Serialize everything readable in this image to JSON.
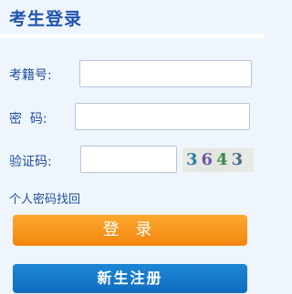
{
  "header": {
    "title": "考生登录"
  },
  "form": {
    "username_label": "考籍号:",
    "username_value": "",
    "password_label": "密  码:",
    "password_value": "",
    "captcha_label": "验证码:",
    "captcha_value": "",
    "captcha_image_text": [
      "3",
      "6",
      "4",
      "3"
    ]
  },
  "links": {
    "forgot_password": "个人密码找回"
  },
  "buttons": {
    "login_label": "登 录",
    "register_label": "新生注册"
  },
  "colors": {
    "title": "#1f55b0",
    "login_button": "#f6920f",
    "register_button": "#1677cb",
    "background": "#eef5fd"
  }
}
